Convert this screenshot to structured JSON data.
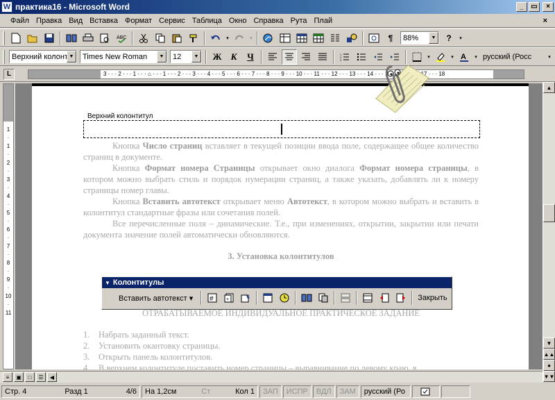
{
  "window": {
    "title": "практика16 - Microsoft Word",
    "icon_letter": "W",
    "minimize": "_",
    "maximize": "▭",
    "close": "×"
  },
  "menu": [
    "Файл",
    "Правка",
    "Вид",
    "Вставка",
    "Формат",
    "Сервис",
    "Таблица",
    "Окно",
    "Справка",
    "Рута",
    "Плай"
  ],
  "menu_close": "×",
  "standard_toolbar": {
    "zoom": "88%"
  },
  "formatting_toolbar": {
    "style": "Верхний колонт",
    "font": "Times New Roman",
    "size": "12",
    "bold": "Ж",
    "italic": "К",
    "underline": "Ч",
    "language": "русский (Росс"
  },
  "ruler": {
    "tab_selector": "L",
    "numbers": "3 · · · 2 · · · 1 · · · ⌂ · · · 1 · · · 2 · · · 3 · · · 4 · · · 5 · · · 6 · · · 7 · · · 8 · · · 9 · · · 10 · · · 11 · · · 12 · · · 13 · · · 14 · · · 15 · · · 16 · · · 17 · · · 18"
  },
  "vruler_numbers": [
    "1",
    "·",
    "1",
    "·",
    "2",
    "·",
    "3",
    "·",
    "4",
    "·",
    "5",
    "·",
    "6",
    "·",
    "7",
    "·",
    "8",
    "·",
    "9",
    "·",
    "10",
    "·",
    "11"
  ],
  "document": {
    "header_label": "Верхний колонтитул",
    "paragraphs": [
      {
        "pre": "Кнопка ",
        "bold": "Число страниц",
        "post": " вставляет в текущей позиции ввода поле, содержащее общее количество страниц в документе."
      },
      {
        "pre": "Кнопка ",
        "bold": "Формат номера Страницы",
        "post": " открывает окно диалога ",
        "bold2": "Формат номера страницы",
        "post2": ", в котором можно выбрать стиль и порядок нумерации страниц, а также указать, добавлять ли к номеру страницы номер главы."
      },
      {
        "pre": "Кнопка ",
        "bold": "Вставить автотекст",
        "post": "  открывает меню ",
        "bold2": "Автотекст",
        "post2": ", в котором можно выбрать и вставить в колонтитул стандартные фразы или сочетания полей."
      },
      {
        "pre": "Все перечисленные поля – динамические. Т.е., при изменениях, открытии, закрытии или печати документа значение полей автоматически обновляются."
      }
    ],
    "section_heading": "3. Установка колонтитулов",
    "task_heading": "ОТРАБАТЫВАЕМОЕ  ИНДИВИДУАЛЬНОЕ ПРАКТИЧЕСКОЕ ЗАДАНИЕ",
    "tasks": [
      {
        "num": "1.",
        "text": "Набрать заданный текст."
      },
      {
        "num": "2.",
        "text": "Установить окантовку страницы."
      },
      {
        "num": "3.",
        "text": "Открыть панель колонтитулов."
      },
      {
        "num": "4.",
        "text": "В верхнем колонтитуле поставить номер страницы – выравнивание по левому краю, в"
      }
    ]
  },
  "hf_toolbar": {
    "title": "Колонтитулы",
    "autotext": "Вставить автотекст ▾",
    "close": "Закрыть"
  },
  "status": {
    "page": "Стр. 4",
    "section": "Разд 1",
    "pages": "4/6",
    "at": "На 1,2см",
    "line": "Ст",
    "col": "Кол 1",
    "rec": "ЗАП",
    "trk": "ИСПР",
    "ext": "ВДЛ",
    "ovr": "ЗАМ",
    "lang": "русский (Ро"
  },
  "colors": {
    "titlebar": "#0a246a",
    "chrome": "#d4d0c8",
    "doc_text": "#a8a8a8"
  }
}
